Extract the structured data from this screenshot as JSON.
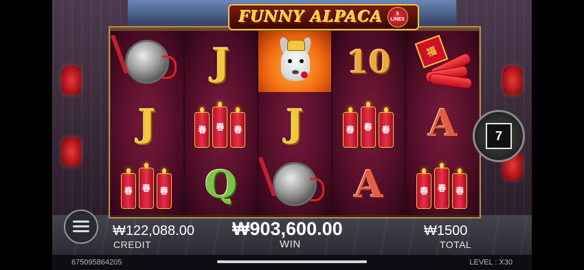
{
  "game": {
    "logo_text": "FUNNY ALPACA",
    "logo_badge_number": "5",
    "logo_badge_label": "LINES"
  },
  "reels": [
    {
      "symbols": [
        "gong",
        "J",
        "firecrackers"
      ]
    },
    {
      "symbols": [
        "J",
        "firecrackers",
        "Q"
      ]
    },
    {
      "symbols": [
        "alpaca-wild",
        "J",
        "gong"
      ]
    },
    {
      "symbols": [
        "10",
        "firecrackers",
        "A"
      ]
    },
    {
      "symbols": [
        "firecracker-bundle",
        "A",
        "firecrackers"
      ]
    }
  ],
  "symbol_text": {
    "J": "J",
    "Q": "Q",
    "A": "A",
    "ten": "10",
    "cracker_char": "春",
    "bundle_char": "福"
  },
  "side_badge": {
    "value": "7"
  },
  "hud": {
    "credit_value": "₩122,088.00",
    "credit_label": "CREDIT",
    "win_value": "₩903,600.00",
    "win_label": "WIN",
    "total_value": "₩1500",
    "total_label": "TOTAL"
  },
  "footer": {
    "session_id": "675095864205",
    "level_text": "LEVEL : X30"
  },
  "colors": {
    "gold": "#f4c63a",
    "reel_bg": "#4a0c24",
    "crimson": "#d0102a"
  }
}
